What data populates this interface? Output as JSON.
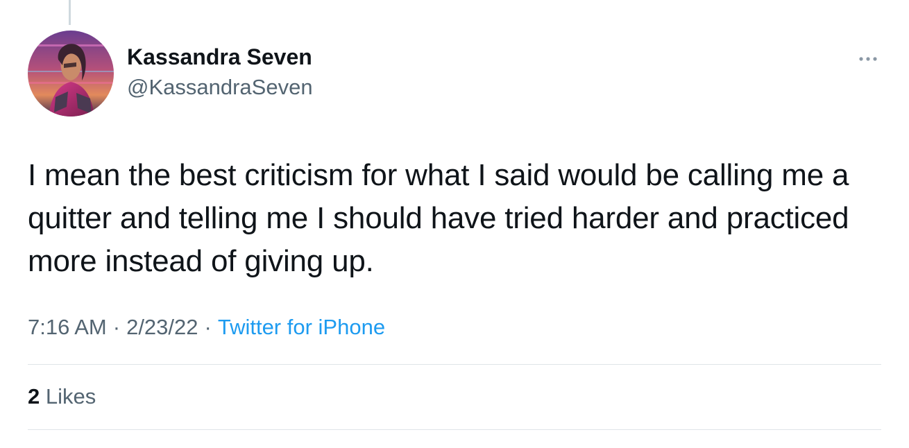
{
  "author": {
    "display_name": "Kassandra Seven",
    "handle": "@KassandraSeven",
    "avatar_icon": "profile-avatar"
  },
  "more_icon": "more-horizontal-icon",
  "tweet": {
    "text": "I mean the best criticism for what I said would be calling me a quitter and telling me I should have tried harder and practiced more instead of giving up.",
    "time": "7:16 AM",
    "date": "2/23/22",
    "separator": "·",
    "source": "Twitter for iPhone"
  },
  "stats": {
    "likes_count": "2",
    "likes_label": "Likes"
  },
  "colors": {
    "text_primary": "#0f1419",
    "text_secondary": "#536471",
    "link": "#1d9bf0",
    "divider": "#dfe4e8"
  }
}
